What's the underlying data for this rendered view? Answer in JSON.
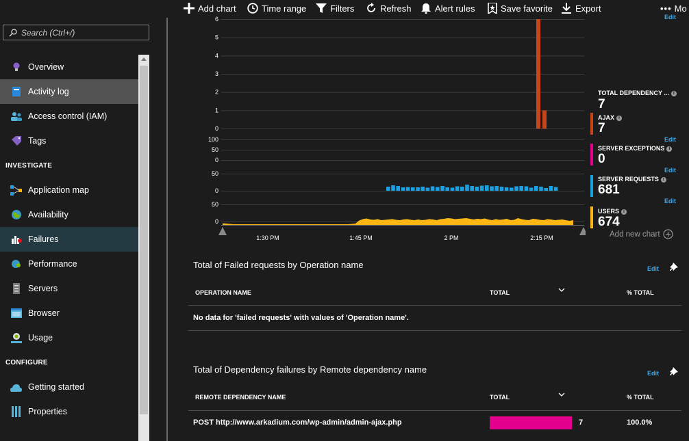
{
  "toolbar": {
    "add_chart": "Add chart",
    "time_range": "Time range",
    "filters": "Filters",
    "refresh": "Refresh",
    "alert_rules": "Alert rules",
    "save_favorite": "Save favorite",
    "export": "Export",
    "more": "Mo"
  },
  "search": {
    "placeholder": "Search (Ctrl+/)"
  },
  "sidebar": {
    "items": [
      {
        "label": "Overview",
        "icon": "lightbulb-icon"
      },
      {
        "label": "Activity log",
        "icon": "activity-log-icon",
        "state": "hover"
      },
      {
        "label": "Access control (IAM)",
        "icon": "people-icon"
      },
      {
        "label": "Tags",
        "icon": "tag-icon"
      }
    ],
    "investigate_header": "INVESTIGATE",
    "investigate_items": [
      {
        "label": "Application map",
        "icon": "app-map-icon"
      },
      {
        "label": "Availability",
        "icon": "globe-icon"
      },
      {
        "label": "Failures",
        "icon": "failures-icon",
        "state": "selected"
      },
      {
        "label": "Performance",
        "icon": "performance-icon"
      },
      {
        "label": "Servers",
        "icon": "server-icon"
      },
      {
        "label": "Browser",
        "icon": "browser-icon"
      },
      {
        "label": "Usage",
        "icon": "usage-icon"
      }
    ],
    "configure_header": "CONFIGURE",
    "configure_items": [
      {
        "label": "Getting started",
        "icon": "cloud-icon"
      },
      {
        "label": "Properties",
        "icon": "properties-icon"
      }
    ]
  },
  "chart_data": {
    "type": "bar",
    "panels": [
      {
        "name": "AJAX",
        "chart_kind": "bar",
        "color": "#c7451a",
        "yticks": [
          "6",
          "5",
          "4",
          "3",
          "2",
          "1",
          "0"
        ],
        "bars": [
          {
            "x": "2:13 PM",
            "value": 6
          },
          {
            "x": "2:14 PM",
            "value": 1
          }
        ]
      },
      {
        "name": "SERVER EXCEPTIONS",
        "chart_kind": "bar",
        "color": "#e3008c",
        "yticks": [
          "100",
          "50",
          "0"
        ],
        "values": []
      },
      {
        "name": "SERVER REQUESTS",
        "chart_kind": "bar",
        "color": "#1ba1e2",
        "yticks": [
          "50",
          "0"
        ],
        "values": [
          12,
          16,
          14,
          10,
          11,
          10,
          10,
          12,
          9,
          13,
          11,
          14,
          10,
          9,
          13,
          12,
          18,
          14,
          12,
          15,
          16,
          13,
          14,
          12,
          10,
          9,
          13,
          14,
          13,
          9,
          14,
          12,
          8,
          14,
          11
        ]
      },
      {
        "name": "USERS",
        "chart_kind": "area",
        "color": "#fcb714",
        "yticks": [
          "50",
          "0"
        ],
        "values": [
          3,
          2,
          1,
          0,
          0,
          0,
          0,
          0,
          0,
          0,
          0,
          0,
          0,
          0,
          0,
          0,
          0,
          0,
          0,
          0,
          0,
          0,
          0,
          0,
          0,
          0,
          0,
          0,
          0,
          0,
          0,
          0,
          0,
          0,
          0,
          1,
          2,
          11,
          15,
          17,
          14,
          13,
          15,
          12,
          13,
          14,
          15,
          13,
          12,
          14,
          15,
          13,
          12,
          14,
          12,
          13,
          15,
          14,
          12,
          15,
          16,
          18,
          17,
          15,
          16,
          17,
          18,
          16,
          14,
          16,
          15,
          17,
          14,
          12,
          15,
          13,
          14,
          16,
          12,
          13,
          18,
          15,
          13,
          12,
          16,
          15,
          13,
          12,
          15,
          14,
          12,
          13,
          14,
          12,
          10,
          12
        ]
      }
    ],
    "x_ticks": [
      "1:30 PM",
      "1:45 PM",
      "2 PM",
      "2:15 PM"
    ]
  },
  "legend": {
    "total_dependency": {
      "label": "TOTAL DEPENDENCY ...",
      "value": "7"
    },
    "ajax": {
      "label": "AJAX",
      "value": "7",
      "color": "#c7451a"
    },
    "server_exceptions": {
      "label": "SERVER EXCEPTIONS",
      "value": "0",
      "color": "#e3008c"
    },
    "server_requests": {
      "label": "SERVER REQUESTS",
      "value": "681",
      "color": "#1ba1e2"
    },
    "users": {
      "label": "USERS",
      "value": "674",
      "color": "#fcb714"
    },
    "edit": "Edit",
    "add_new_chart": "Add new chart"
  },
  "failed_requests": {
    "title": "Total of Failed requests by Operation name",
    "edit": "Edit",
    "columns": [
      "OPERATION NAME",
      "TOTAL",
      "% TOTAL"
    ],
    "empty_message": "No data for 'failed requests' with values of 'Operation name'."
  },
  "dependency_failures": {
    "title": "Total of Dependency failures by Remote dependency name",
    "edit": "Edit",
    "columns": [
      "REMOTE DEPENDENCY NAME",
      "TOTAL",
      "% TOTAL"
    ],
    "rows": [
      {
        "name": "POST http://www.arkadium.com/wp-admin/admin-ajax.php",
        "total": "7",
        "total_fraction": 1.0,
        "percent": "100.0%",
        "bar_color": "#e3008c"
      }
    ]
  }
}
